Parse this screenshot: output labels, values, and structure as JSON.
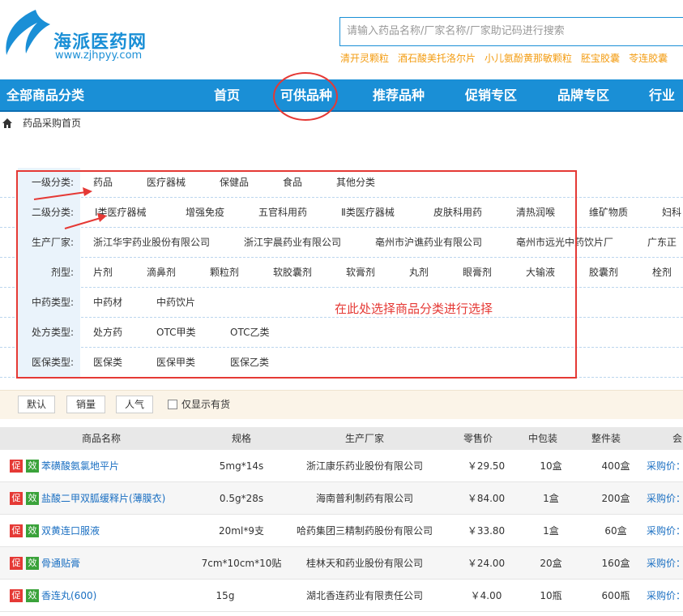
{
  "header": {
    "site_name": "海派医药网",
    "site_url": "www.zjhpyy.com",
    "search_placeholder": "请输入药品名称/厂家名称/厂家助记码进行搜索",
    "hot_keywords": [
      "清开灵颗粒",
      "酒石酸美托洛尔片",
      "小儿氨酚黄那敏颗粒",
      "胚宝胶囊",
      "苓连胶囊"
    ]
  },
  "nav": {
    "all_categories": "全部商品分类",
    "items": [
      "首页",
      "可供品种",
      "推荐品种",
      "促销专区",
      "品牌专区",
      "行业资"
    ]
  },
  "breadcrumb": "药品采购首页",
  "filters": [
    {
      "label": "一级分类:",
      "options": [
        "药品",
        "医疗器械",
        "保健品",
        "食品",
        "其他分类"
      ]
    },
    {
      "label": "二级分类:",
      "options": [
        "Ⅰ类医疗器械",
        "增强免疫",
        "五官科用药",
        "Ⅱ类医疗器械",
        "皮肤科用药",
        "清热润喉",
        "维矿物质",
        "妇科"
      ]
    },
    {
      "label": "生产厂家:",
      "options": [
        "浙江华宇药业股份有限公司",
        "浙江宇晨药业有限公司",
        "亳州市沪谯药业有限公司",
        "亳州市远光中药饮片厂",
        "广东正"
      ]
    },
    {
      "label": "剂型:",
      "options": [
        "片剂",
        "滴鼻剂",
        "颗粒剂",
        "软胶囊剂",
        "软膏剂",
        "丸剂",
        "眼膏剂",
        "大输液",
        "胶囊剂",
        "栓剂"
      ]
    },
    {
      "label": "中药类型:",
      "options": [
        "中药材",
        "中药饮片"
      ]
    },
    {
      "label": "处方类型:",
      "options": [
        "处方药",
        "OTC甲类",
        "OTC乙类"
      ]
    },
    {
      "label": "医保类型:",
      "options": [
        "医保类",
        "医保甲类",
        "医保乙类"
      ]
    }
  ],
  "annotation": "在此处选择商品分类进行选择",
  "sort": {
    "buttons": [
      "默认",
      "销量",
      "人气"
    ],
    "in_stock_label": "仅显示有货"
  },
  "table": {
    "headers": [
      "商品名称",
      "规格",
      "生产厂家",
      "零售价",
      "中包装",
      "整件装",
      "会"
    ],
    "badge_promo": "促",
    "badge_effect": "效",
    "rows": [
      {
        "name": "苯磺酸氨氯地平片",
        "spec": "5mg*14s",
        "maker": "浙江康乐药业股份有限公司",
        "price": "￥29.50",
        "mid": "10盒",
        "whole": "400盒",
        "action": "采购价："
      },
      {
        "name": "盐酸二甲双胍缓释片(薄膜衣)",
        "spec": "0.5g*28s",
        "maker": "海南普利制药有限公司",
        "price": "￥84.00",
        "mid": "1盒",
        "whole": "200盒",
        "action": "采购价："
      },
      {
        "name": "双黄连口服液",
        "spec": "20ml*9支",
        "maker": "哈药集团三精制药股份有限公司",
        "price": "￥33.80",
        "mid": "1盒",
        "whole": "60盒",
        "action": "采购价："
      },
      {
        "name": "骨通贴膏",
        "spec": "7cm*10cm*10贴",
        "maker": "桂林天和药业股份有限公司",
        "price": "￥24.00",
        "mid": "20盒",
        "whole": "160盒",
        "action": "采购价："
      },
      {
        "name": "香连丸(600)",
        "spec": "15g",
        "maker": "湖北香连药业有限责任公司",
        "price": "￥4.00",
        "mid": "10瓶",
        "whole": "600瓶",
        "action": "采购价："
      }
    ]
  },
  "colors": {
    "brand_blue": "#1a8fd6",
    "annotation_red": "#e53935",
    "hot_orange": "#f39c12"
  }
}
